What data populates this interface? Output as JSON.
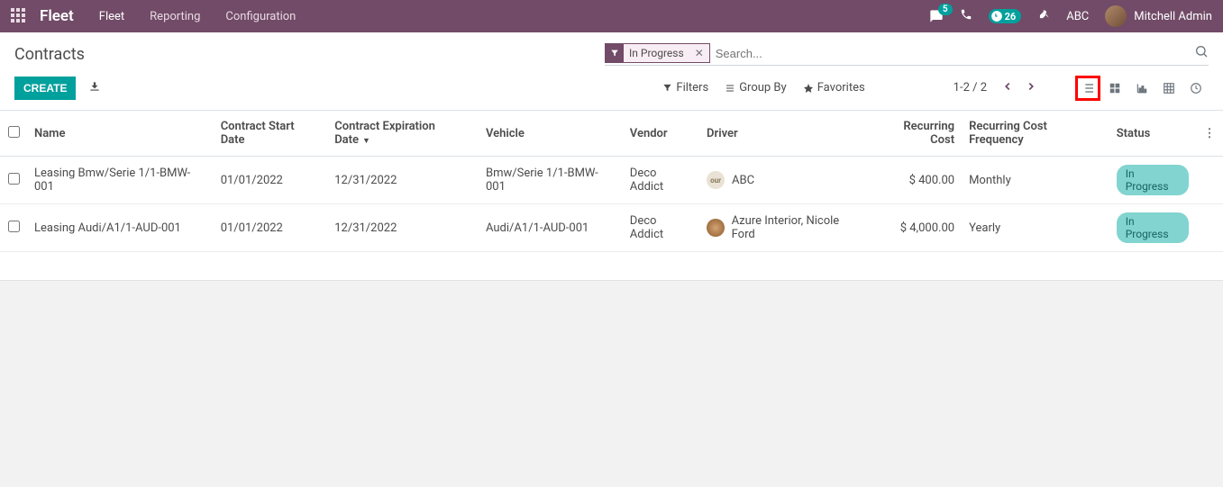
{
  "nav": {
    "app": "Fleet",
    "links": [
      "Fleet",
      "Reporting",
      "Configuration"
    ],
    "msg_count": "5",
    "activity_count": "26",
    "company": "ABC",
    "user": "Mitchell Admin"
  },
  "control": {
    "title": "Contracts",
    "filter_chip": "In Progress",
    "search_placeholder": "Search...",
    "create": "CREATE",
    "filters": "Filters",
    "groupby": "Group By",
    "favorites": "Favorites",
    "pager": "1-2 / 2"
  },
  "table": {
    "headers": {
      "name": "Name",
      "start": "Contract Start Date",
      "exp": "Contract Expiration Date",
      "vehicle": "Vehicle",
      "vendor": "Vendor",
      "driver": "Driver",
      "rcost": "Recurring Cost",
      "rfreq": "Recurring Cost Frequency",
      "status": "Status"
    },
    "rows": [
      {
        "name": "Leasing Bmw/Serie 1/1-BMW-001",
        "start": "01/01/2022",
        "exp": "12/31/2022",
        "vehicle": "Bmw/Serie 1/1-BMW-001",
        "vendor": "Deco Addict",
        "driver": "ABC",
        "driver_type": "company",
        "rcost": "$ 400.00",
        "rfreq": "Monthly",
        "status": "In Progress"
      },
      {
        "name": "Leasing Audi/A1/1-AUD-001",
        "start": "01/01/2022",
        "exp": "12/31/2022",
        "vehicle": "Audi/A1/1-AUD-001",
        "vendor": "Deco Addict",
        "driver": "Azure Interior, Nicole Ford",
        "driver_type": "person",
        "rcost": "$ 4,000.00",
        "rfreq": "Yearly",
        "status": "In Progress"
      }
    ]
  }
}
